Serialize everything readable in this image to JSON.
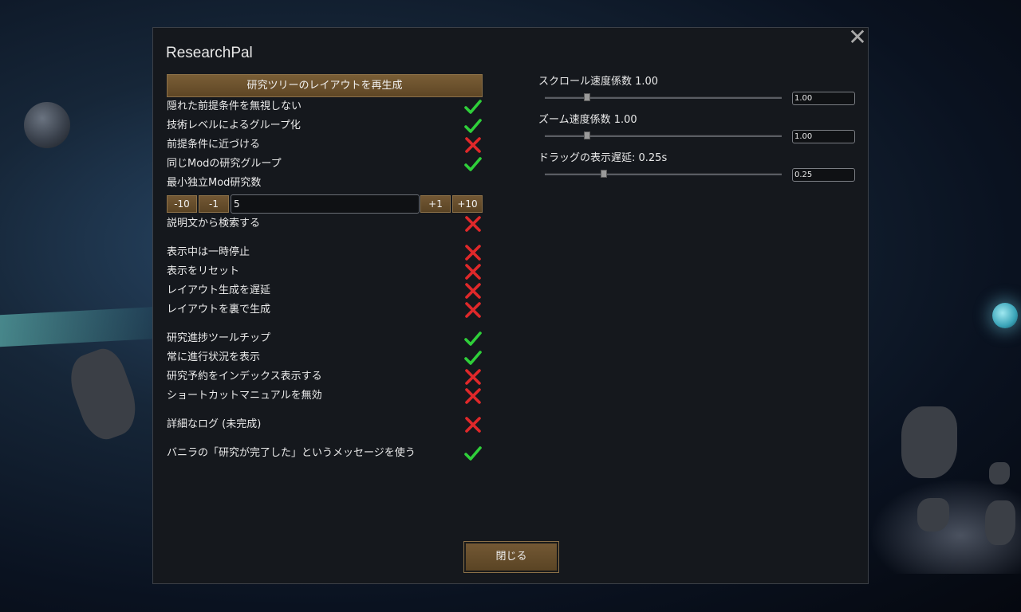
{
  "window": {
    "title": "ResearchPal",
    "close_glyph": "✕"
  },
  "left": {
    "regen_button": "研究ツリーのレイアウトを再生成",
    "group1": [
      {
        "label": "隠れた前提条件を無視しない",
        "value": true
      },
      {
        "label": "技術レベルによるグループ化",
        "value": true
      },
      {
        "label": "前提条件に近づける",
        "value": false
      },
      {
        "label": "同じModの研究グループ",
        "value": true
      }
    ],
    "min_mod_label": "最小独立Mod研究数",
    "stepper": {
      "minus10": "-10",
      "minus1": "-1",
      "value": "5",
      "plus1": "+1",
      "plus10": "+10"
    },
    "search_desc": {
      "label": "説明文から検索する",
      "value": false
    },
    "group2": [
      {
        "label": "表示中は一時停止",
        "value": false
      },
      {
        "label": "表示をリセット",
        "value": false
      },
      {
        "label": "レイアウト生成を遅延",
        "value": false
      },
      {
        "label": "レイアウトを裏で生成",
        "value": false
      }
    ],
    "group3": [
      {
        "label": "研究進捗ツールチップ",
        "value": true
      },
      {
        "label": "常に進行状況を表示",
        "value": true
      },
      {
        "label": "研究予約をインデックス表示する",
        "value": false
      },
      {
        "label": "ショートカットマニュアルを無効",
        "value": false
      }
    ],
    "verbose_log": {
      "label": "詳細なログ (未完成)",
      "value": false
    },
    "vanilla_msg": {
      "label": "バニラの「研究が完了した」というメッセージを使う",
      "value": true
    }
  },
  "right": {
    "sliders": [
      {
        "label": "スクロール速度係数 1.00",
        "input": "1.00",
        "fraction": 0.18
      },
      {
        "label": "ズーム速度係数 1.00",
        "input": "1.00",
        "fraction": 0.18
      },
      {
        "label": "ドラッグの表示遅延: 0.25s",
        "input": "0.25",
        "fraction": 0.25
      }
    ]
  },
  "footer": {
    "close_button": "閉じる"
  },
  "icons": {
    "check": "check-icon",
    "cross": "cross-icon"
  },
  "colors": {
    "check": "#2fcf3a",
    "cross": "#e0282a",
    "button": "#6a5030",
    "panel": "#15181d"
  }
}
